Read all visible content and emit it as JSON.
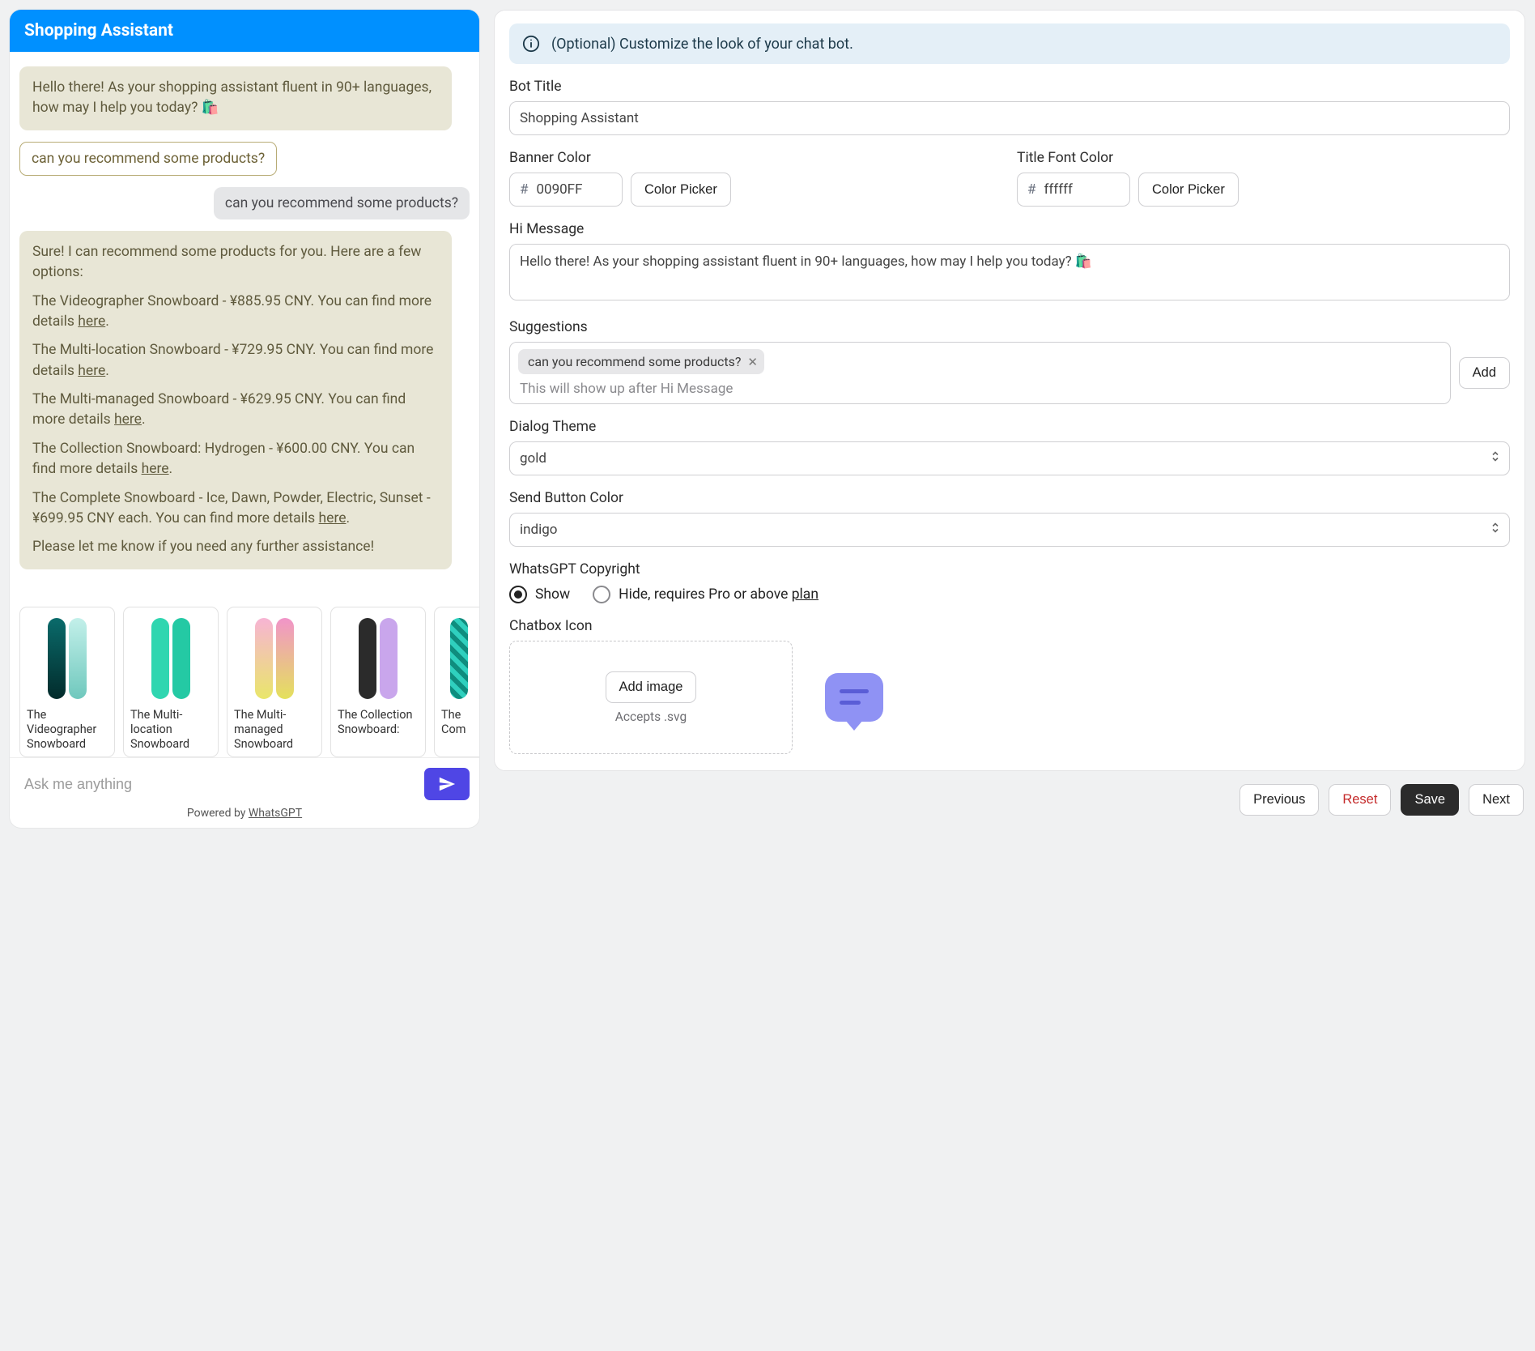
{
  "chat": {
    "title": "Shopping Assistant",
    "bot_intro": "Hello there! As your shopping assistant fluent in 90+ languages, how may I help you today? 🛍️",
    "suggestion_chip": "can you recommend some products?",
    "user_msg": "can you recommend some products?",
    "reply": {
      "intro": "Sure! I can recommend some products for you. Here are a few options:",
      "items": [
        {
          "pre": "The Videographer Snowboard - ¥885.95 CNY. You can find more details ",
          "link": "here",
          "post": "."
        },
        {
          "pre": "The Multi-location Snowboard - ¥729.95 CNY. You can find more details ",
          "link": "here",
          "post": "."
        },
        {
          "pre": "The Multi-managed Snowboard - ¥629.95 CNY. You can find more details ",
          "link": "here",
          "post": "."
        },
        {
          "pre": "The Collection Snowboard: Hydrogen - ¥600.00 CNY. You can find more details ",
          "link": "here",
          "post": "."
        },
        {
          "pre": "The Complete Snowboard - Ice, Dawn, Powder, Electric, Sunset - ¥699.95 CNY each. You can find more details ",
          "link": "here",
          "post": "."
        }
      ],
      "outro": "Please let me know if you need any further assistance!"
    },
    "products": [
      {
        "name": "The Videographer Snowboard"
      },
      {
        "name": "The Multi-location Snowboard"
      },
      {
        "name": "The Multi-managed Snowboard"
      },
      {
        "name": "The Collection Snowboard:"
      },
      {
        "name": "The Com"
      }
    ],
    "input_placeholder": "Ask me anything",
    "powered_pre": "Powered by ",
    "powered_link": "WhatsGPT"
  },
  "settings": {
    "banner": "(Optional) Customize the look of your chat bot.",
    "labels": {
      "bot_title": "Bot Title",
      "banner_color": "Banner Color",
      "title_font_color": "Title Font Color",
      "hi_message": "Hi Message",
      "suggestions": "Suggestions",
      "dialog_theme": "Dialog Theme",
      "send_button_color": "Send Button Color",
      "copyright": "WhatsGPT Copyright",
      "chatbox_icon": "Chatbox Icon"
    },
    "values": {
      "bot_title": "Shopping Assistant",
      "banner_color": "0090FF",
      "title_font_color": "ffffff",
      "hi_message": "Hello there! As your shopping assistant fluent in 90+ languages, how may I help you today? 🛍️",
      "suggestion_tag": "can you recommend some products?",
      "suggestions_placeholder": "This will show up after Hi Message",
      "dialog_theme": "gold",
      "send_button_color": "indigo"
    },
    "buttons": {
      "color_picker": "Color Picker",
      "add": "Add",
      "add_image": "Add image",
      "previous": "Previous",
      "reset": "Reset",
      "save": "Save",
      "next": "Next"
    },
    "copyright_options": {
      "show": "Show",
      "hide_pre": "Hide, requires Pro or above ",
      "hide_link": "plan"
    },
    "dropzone_hint": "Accepts .svg",
    "hash": "#"
  }
}
